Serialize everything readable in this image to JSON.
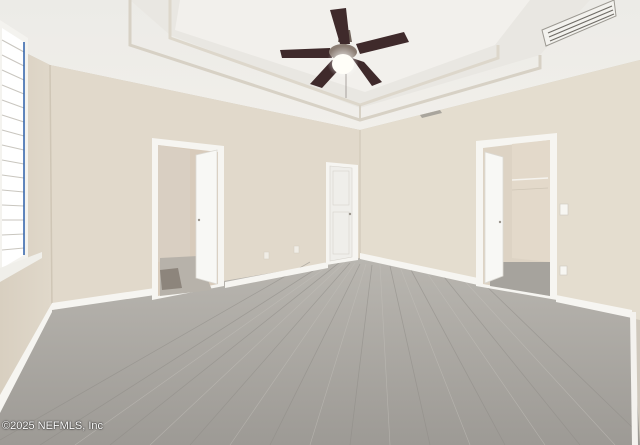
{
  "watermark": "©2025 NEFMLS, Inc",
  "colors": {
    "wall": "#e2dbcd",
    "wall_shadow": "#cfc7b8",
    "ceiling": "#efece6",
    "trim": "#f7f6f2",
    "floor": "#a9a6a1",
    "fan_blade": "#3f2a2b"
  },
  "objects": [
    "ceiling-fan-icon",
    "air-vent-icon",
    "window-blinds",
    "bathroom-doorway",
    "closet-door",
    "walk-in-closet-doorway",
    "laminate-floor"
  ]
}
